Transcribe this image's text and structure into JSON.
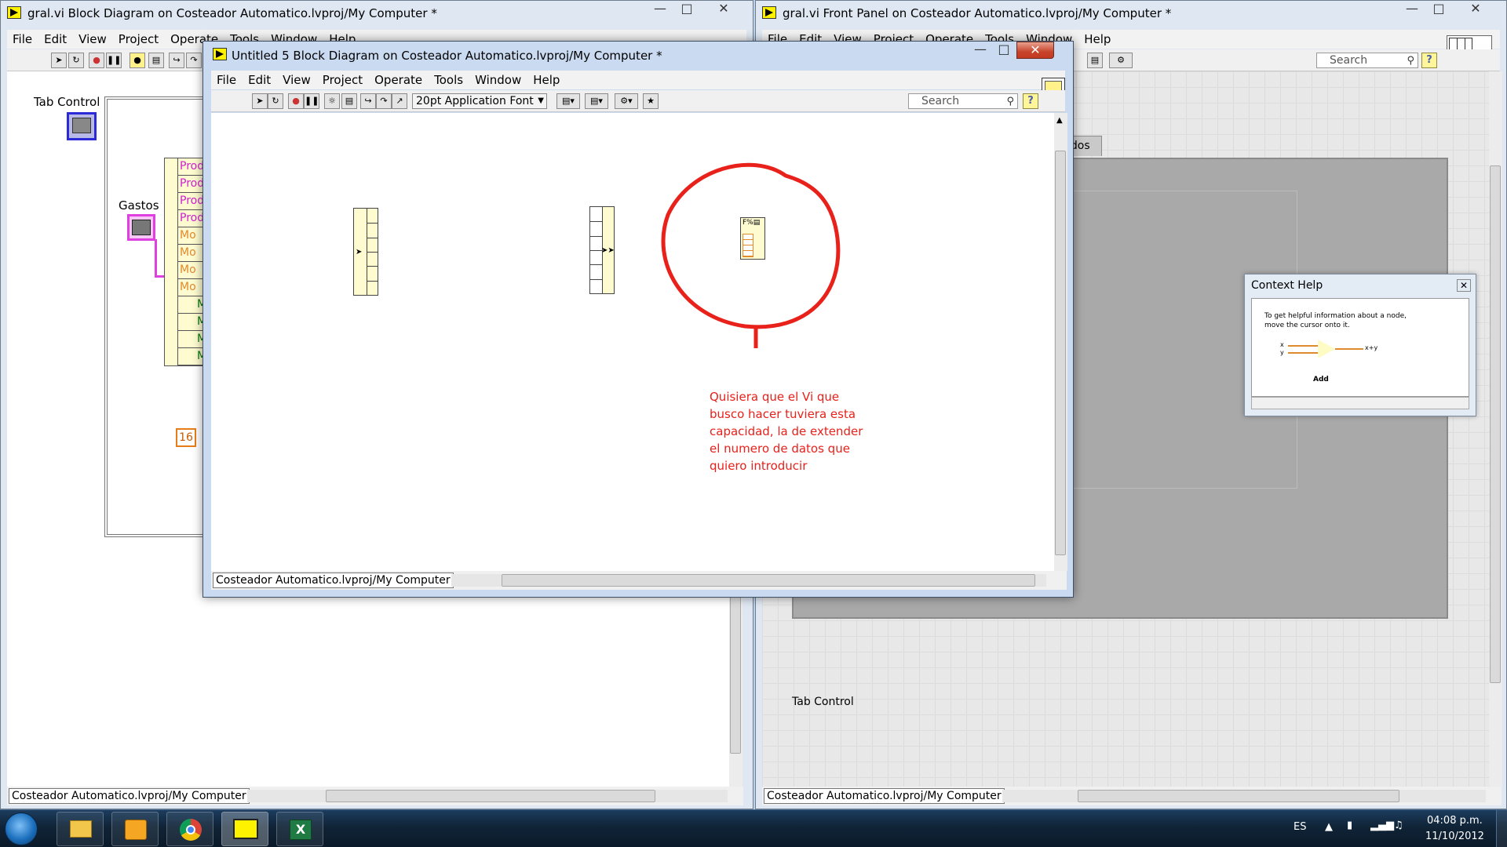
{
  "left_window": {
    "title": "gral.vi Block Diagram on Costeador Automatico.lvproj/My Computer *",
    "menu": [
      "File",
      "Edit",
      "View",
      "Project",
      "Operate",
      "Tools",
      "Window",
      "Help"
    ],
    "labels": {
      "tab_control": "Tab Control",
      "gastos": "Gastos",
      "constant": "16"
    },
    "cluster_items": [
      "Prod",
      "Prod",
      "Prod",
      "Prod",
      "Mo",
      "Mo",
      "Mo",
      "Mo",
      "M",
      "M",
      "M",
      "M"
    ],
    "status_path": "Costeador Automatico.lvproj/My Computer"
  },
  "right_window": {
    "title": "gral.vi Front Panel on Costeador Automatico.lvproj/My Computer *",
    "menu": [
      "File",
      "Edit",
      "View",
      "Project",
      "Operate",
      "Tools",
      "Window",
      "Help"
    ],
    "search_placeholder": "Search",
    "tab_label": "idos",
    "tab_control_label": "Tab Control",
    "status_path": "Costeador Automatico.lvproj/My Computer"
  },
  "dialog_window": {
    "title": "Untitled 5 Block Diagram on Costeador Automatico.lvproj/My Computer *",
    "menu": [
      "File",
      "Edit",
      "View",
      "Project",
      "Operate",
      "Tools",
      "Window",
      "Help"
    ],
    "font_selector": "20pt Application Font",
    "search_placeholder": "Search",
    "annotation": "Quisiera que el Vi que busco hacer tuviera esta capacidad, la de extender el numero de datos que quiero introducir",
    "status_path": "Costeador Automatico.lvproj/My Computer",
    "annotation_color": "#e8211b"
  },
  "context_help": {
    "title": "Context Help",
    "text": "To get helpful information about a node, move the cursor onto it.",
    "input_x": "x",
    "input_y": "y",
    "output": "x+y",
    "node_name": "Add"
  },
  "taskbar": {
    "language": "ES",
    "time": "04:08 p.m.",
    "date": "11/10/2012",
    "apps": [
      "explorer-icon",
      "outlook-icon",
      "chrome-icon",
      "labview-icon",
      "excel-icon"
    ]
  }
}
